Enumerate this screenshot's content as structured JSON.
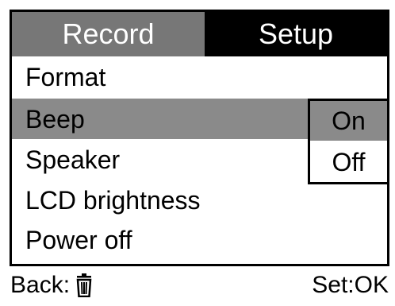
{
  "tabs": {
    "record": "Record",
    "setup": "Setup"
  },
  "menu": {
    "items": [
      {
        "label": "Format"
      },
      {
        "label": "Beep"
      },
      {
        "label": "Speaker"
      },
      {
        "label": "LCD brightness"
      },
      {
        "label": "Power off"
      }
    ],
    "selected_index": 1
  },
  "submenu": {
    "options": [
      {
        "label": "On"
      },
      {
        "label": "Off"
      }
    ],
    "selected": "On"
  },
  "footer": {
    "back_label": "Back:",
    "back_icon": "trash-icon",
    "set_label": "Set:OK"
  },
  "colors": {
    "highlight": "#8a8a8a",
    "active_tab": "#000000",
    "inactive_tab": "#777777"
  }
}
